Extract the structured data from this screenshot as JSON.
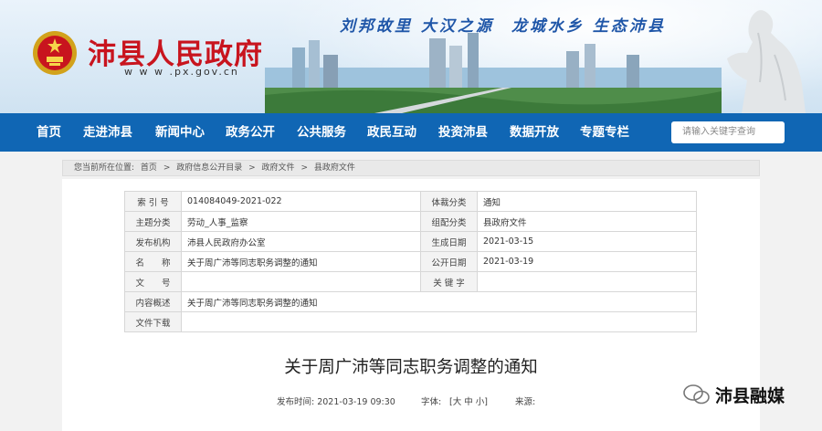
{
  "header": {
    "site_title": "沛县人民政府",
    "site_url": "w w w .px.gov.cn",
    "slogan_1": "刘邦故里  大汉之源",
    "slogan_2": "龙城水乡  生态沛县"
  },
  "nav": {
    "items": [
      "首页",
      "走进沛县",
      "新闻中心",
      "政务公开",
      "公共服务",
      "政民互动",
      "投资沛县",
      "数据开放",
      "专题专栏"
    ],
    "search_placeholder": "请输入关键字查询"
  },
  "breadcrumb": {
    "prefix": "您当前所在位置:",
    "items": [
      "首页",
      "政府信息公开目录",
      "政府文件",
      "县政府文件"
    ],
    "separator": ">"
  },
  "info_table": {
    "rows": [
      {
        "k1": "索 引 号",
        "v1": "014084049-2021-022",
        "k2": "体裁分类",
        "v2": "通知"
      },
      {
        "k1": "主题分类",
        "v1": "劳动_人事_监察",
        "k2": "组配分类",
        "v2": "县政府文件"
      },
      {
        "k1": "发布机构",
        "v1": "沛县人民政府办公室",
        "k2": "生成日期",
        "v2": "2021-03-15"
      },
      {
        "k1": "名　　称",
        "v1": "关于周广沛等同志职务调整的通知",
        "k2": "公开日期",
        "v2": "2021-03-19"
      },
      {
        "k1": "文　　号",
        "v1": "",
        "k2": "关 键 字",
        "v2": ""
      }
    ],
    "summary_label": "内容概述",
    "summary_value": "关于周广沛等同志职务调整的通知",
    "download_label": "文件下载",
    "download_value": ""
  },
  "document": {
    "title": "关于周广沛等同志职务调整的通知",
    "publish_time": "发布时间: 2021-03-19 09:30",
    "font_label": "字体:",
    "font_size_options": "[大 中 小]",
    "source_label": "来源:"
  },
  "watermark": {
    "text": "沛县融媒"
  },
  "colors": {
    "nav_bg": "#1066b4",
    "title_red": "#c8141e",
    "slogan_blue": "#1f56a8"
  }
}
